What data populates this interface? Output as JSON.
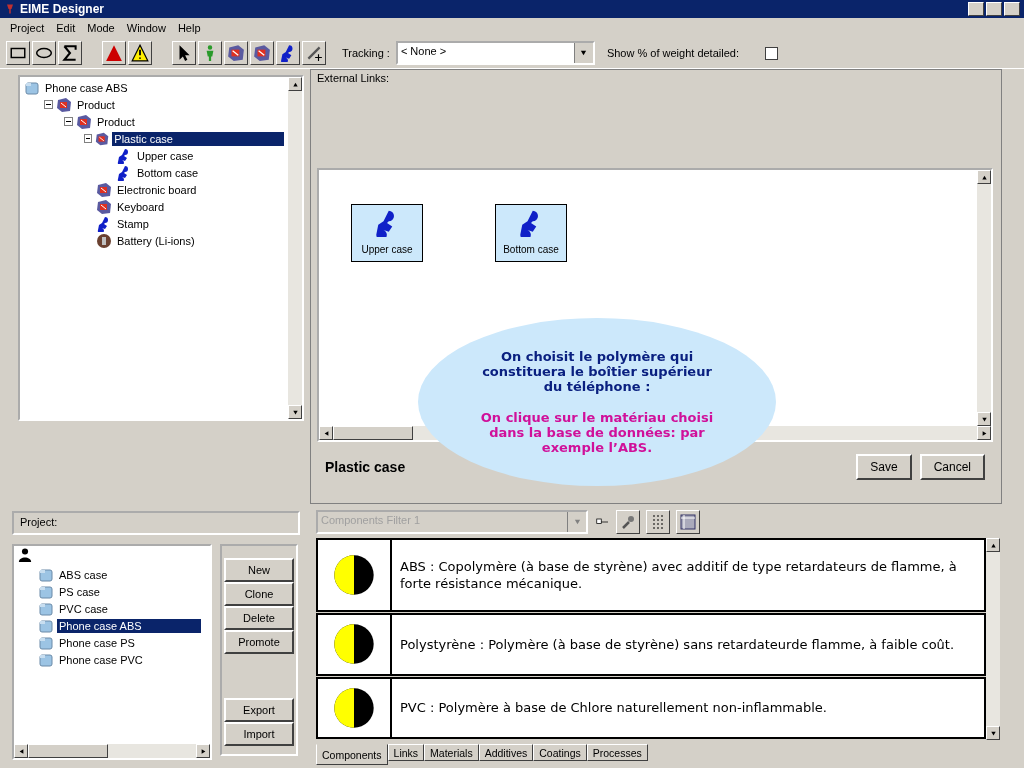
{
  "window": {
    "title": "EIME Designer"
  },
  "menu": [
    "Project",
    "Edit",
    "Mode",
    "Window",
    "Help"
  ],
  "toolbar": {
    "tools": [
      {
        "kind": "rectangle"
      },
      {
        "kind": "ellipse"
      },
      {
        "kind": "sigma"
      },
      {
        "kind": "alert"
      },
      {
        "kind": "warning"
      },
      {
        "kind": "pointer"
      },
      {
        "kind": "figure"
      },
      {
        "kind": "product"
      },
      {
        "kind": "product"
      },
      {
        "kind": "component"
      },
      {
        "kind": "link"
      }
    ]
  },
  "tracking": {
    "label": "Tracking :",
    "value": "< None >"
  },
  "weight_detail": {
    "label": "Show % of weight detailed:",
    "checked": false
  },
  "product_tree": [
    {
      "label": "Phone case ABS",
      "kind": "project",
      "selected": false,
      "children": [
        {
          "label": "Product",
          "kind": "product",
          "selected": false,
          "expanded": true,
          "children": [
            {
              "label": "Product",
              "kind": "product",
              "selected": false,
              "expanded": true,
              "children": [
                {
                  "label": "Plastic case",
                  "kind": "product",
                  "selected": true,
                  "expanded": true,
                  "children": [
                    {
                      "label": "Upper case",
                      "kind": "component",
                      "selected": false
                    },
                    {
                      "label": "Bottom case",
                      "kind": "component",
                      "selected": false
                    }
                  ]
                },
                {
                  "label": "Electronic board",
                  "kind": "product",
                  "selected": false
                },
                {
                  "label": "Keyboard",
                  "kind": "product",
                  "selected": false
                },
                {
                  "label": "Stamp",
                  "kind": "component",
                  "selected": false
                },
                {
                  "label": "Battery (Li-ions)",
                  "kind": "battery",
                  "selected": false
                }
              ]
            }
          ]
        }
      ]
    }
  ],
  "external_links": {
    "label": "External Links:"
  },
  "canvas": {
    "nodes": [
      {
        "label": "Upper case"
      },
      {
        "label": "Bottom case"
      }
    ]
  },
  "selected_name": "Plastic case",
  "buttons": [
    "Save",
    "Cancel"
  ],
  "callout": {
    "intro": "On choisit le polymère qui constituera le boîtier supérieur du téléphone :",
    "instruction": "On clique sur le matériau choisi dans la base de données: par exemple l’ABS."
  },
  "project": {
    "label": "Project:"
  },
  "project_tree": [
    {
      "label": "ABS case",
      "selected": false
    },
    {
      "label": "PS case",
      "selected": false
    },
    {
      "label": "PVC case",
      "selected": false
    },
    {
      "label": "Phone case ABS",
      "selected": true
    },
    {
      "label": "Phone case PS",
      "selected": false
    },
    {
      "label": "Phone case PVC",
      "selected": false
    }
  ],
  "project_actions": [
    "New",
    "Clone",
    "Delete",
    "Promote"
  ],
  "transfer_actions": [
    "Export",
    "Import"
  ],
  "components_filter": {
    "value": "Components Filter 1",
    "disabled": true
  },
  "materials": [
    {
      "description": "ABS : Copolymère (à base de styrène) avec additif de type retardateurs de flamme, à forte résistance mécanique."
    },
    {
      "description": "Polystyrène : Polymère (à base de styrène) sans retardateurde flamme, à faible coût."
    },
    {
      "description": "PVC : Polymère à base de Chlore naturellement non-inflammable."
    }
  ],
  "tabs": [
    {
      "label": "Components",
      "selected": true
    },
    {
      "label": "Links",
      "selected": false
    },
    {
      "label": "Materials",
      "selected": false
    },
    {
      "label": "Additives",
      "selected": false
    },
    {
      "label": "Coatings",
      "selected": false
    },
    {
      "label": "Processes",
      "selected": false
    }
  ]
}
